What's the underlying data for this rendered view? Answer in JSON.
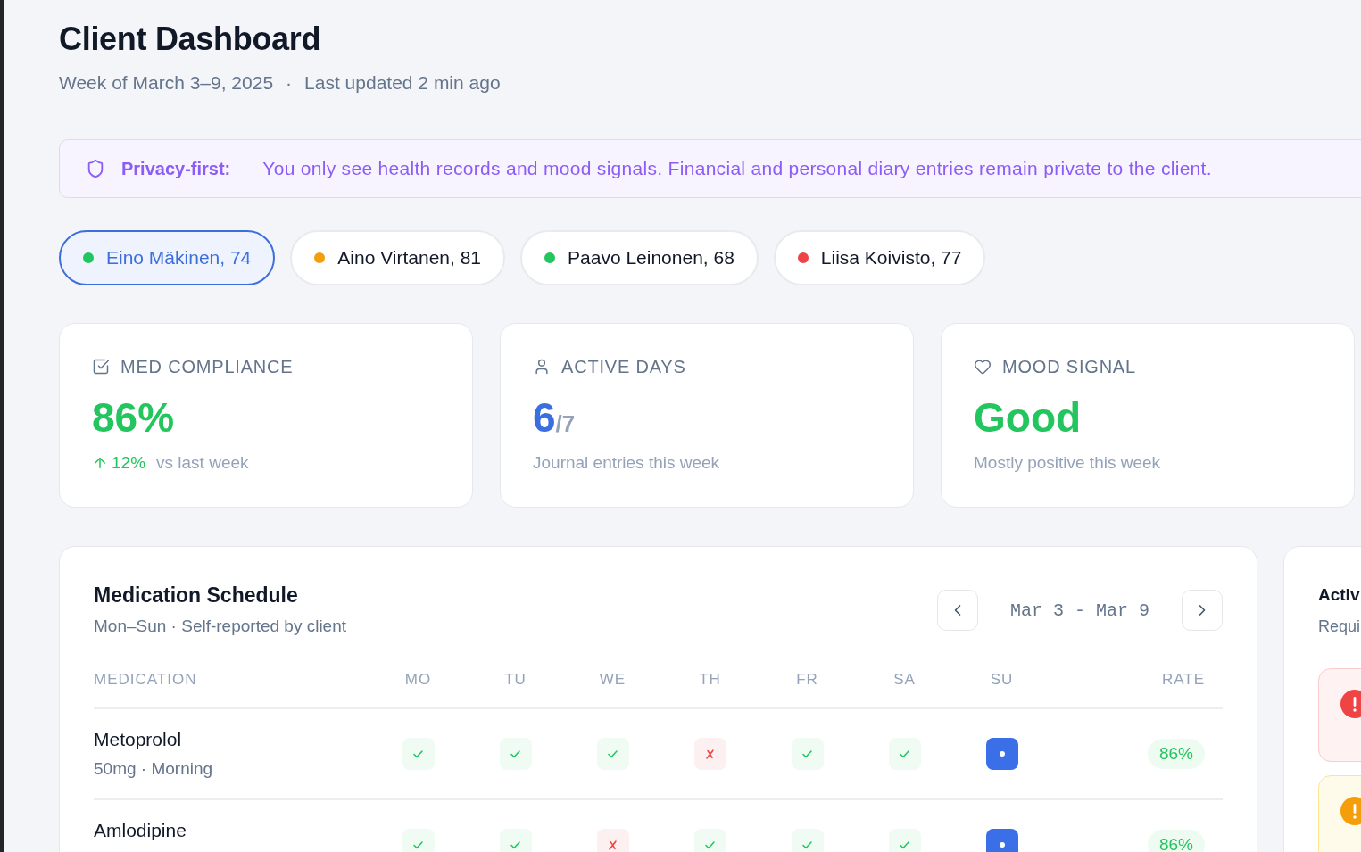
{
  "header": {
    "title": "Client Dashboard",
    "subtitle": "Week of March 3–9, 2025",
    "separator": "·",
    "updated": "Last updated 2 min ago"
  },
  "privacy_banner": {
    "label": "Privacy-first:",
    "message": "You only see health records and mood signals. Financial and personal diary entries remain private to the client."
  },
  "clients": [
    {
      "name": "Eino Mäkinen, 74",
      "color": "#22c55e",
      "selected": true
    },
    {
      "name": "Aino Virtanen, 81",
      "color": "#f59e0b",
      "selected": false
    },
    {
      "name": "Paavo Leinonen, 68",
      "color": "#22c55e",
      "selected": false
    },
    {
      "name": "Liisa Koivisto, 77",
      "color": "#ef4444",
      "selected": false
    }
  ],
  "stats": [
    {
      "kind": "compliance",
      "label": "MED COMPLIANCE",
      "value": "86%",
      "rising": true,
      "change": "12%",
      "note": "vs last week"
    },
    {
      "kind": "days",
      "label": "ACTIVE DAYS",
      "value": "6",
      "total": "/7",
      "note": "Journal entries this week"
    },
    {
      "kind": "mood",
      "label": "MOOD SIGNAL",
      "value": "Good",
      "note": "Mostly positive this week"
    }
  ],
  "medication_schedule": {
    "title": "Medication Schedule",
    "subtitle": "Mon–Sun · Self-reported by client",
    "date_range": "Mar 3 - Mar 9",
    "columns": [
      "MEDICATION",
      "MO",
      "TU",
      "WE",
      "TH",
      "FR",
      "SA",
      "SU",
      "RATE"
    ],
    "rows": [
      {
        "name": "Metoprolol",
        "detail": "50mg · Morning",
        "doses": [
          {
            "kind": "taken"
          },
          {
            "kind": "taken"
          },
          {
            "kind": "taken"
          },
          {
            "kind": "missed"
          },
          {
            "kind": "taken"
          },
          {
            "kind": "taken"
          },
          {
            "kind": "pending"
          }
        ],
        "rate": "86%"
      },
      {
        "name": "Amlodipine",
        "doses": [
          {
            "kind": "taken"
          },
          {
            "kind": "taken"
          },
          {
            "kind": "missed"
          },
          {
            "kind": "taken"
          },
          {
            "kind": "taken"
          },
          {
            "kind": "taken"
          },
          {
            "kind": "pending"
          }
        ],
        "rate": "86%"
      }
    ]
  },
  "side_panel": {
    "title": "Activ",
    "subtitle": "Requi",
    "alerts": [
      {
        "kind": "critical"
      },
      {
        "kind": "warning"
      }
    ]
  }
}
